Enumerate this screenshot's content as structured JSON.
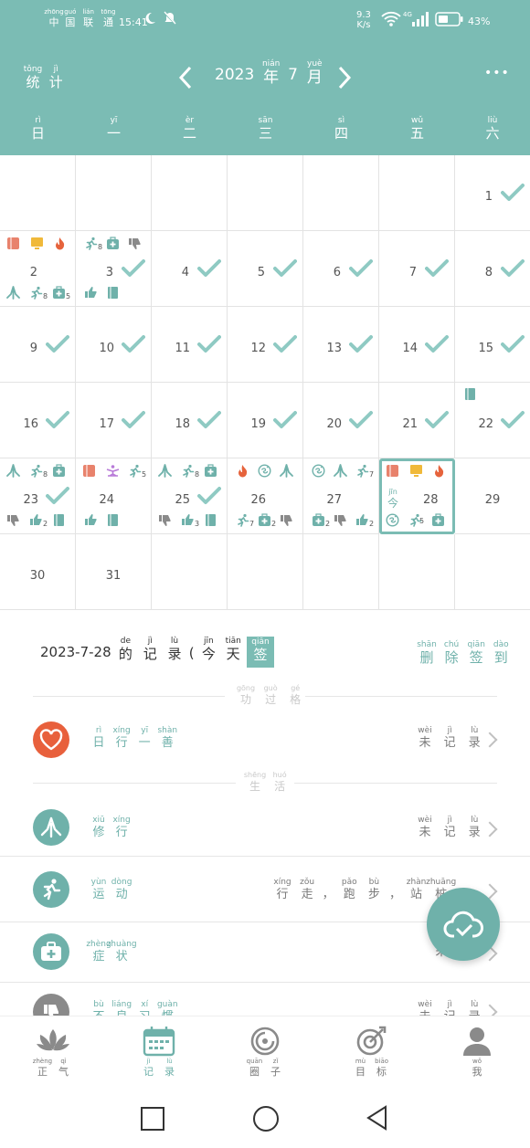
{
  "status_bar": {
    "carrier": [
      {
        "py": "zhōng",
        "hz": "中"
      },
      {
        "py": "guó",
        "hz": "国"
      },
      {
        "py": "lián",
        "hz": "联"
      },
      {
        "py": "tōng",
        "hz": "通"
      }
    ],
    "time": "15:41",
    "net_speed_top": "9.3",
    "net_speed_bottom": "K/s",
    "net_type": "4G",
    "battery": "43%"
  },
  "header": {
    "stats": [
      {
        "py": "tǒng",
        "hz": "统"
      },
      {
        "py": "jì",
        "hz": "计"
      }
    ],
    "year": "2023",
    "year_char": {
      "py": "nián",
      "hz": "年"
    },
    "month": "7",
    "month_char": {
      "py": "yuè",
      "hz": "月"
    },
    "more": "•••"
  },
  "weekdays": [
    {
      "py": "rì",
      "hz": "日"
    },
    {
      "py": "yī",
      "hz": "一"
    },
    {
      "py": "èr",
      "hz": "二"
    },
    {
      "py": "sān",
      "hz": "三"
    },
    {
      "py": "sì",
      "hz": "四"
    },
    {
      "py": "wǔ",
      "hz": "五"
    },
    {
      "py": "liù",
      "hz": "六"
    }
  ],
  "calendar": {
    "days": [
      "1",
      "2",
      "3",
      "4",
      "5",
      "6",
      "7",
      "8",
      "9",
      "10",
      "11",
      "12",
      "13",
      "14",
      "15",
      "16",
      "17",
      "18",
      "19",
      "20",
      "21",
      "22",
      "23",
      "24",
      "25",
      "26",
      "27",
      "28",
      "29",
      "30",
      "31"
    ],
    "today_label": {
      "py": "jīn",
      "hz": "今"
    },
    "icon_counts": {
      "d2_run": "8",
      "d2_med": "5",
      "d3_run": "8",
      "d23_run": "8",
      "d23_thumb": "2",
      "d24_run": "5",
      "d25_run": "8",
      "d25_thumb": "3",
      "d26_run": "7",
      "d26_med": "2",
      "d27_run": "7",
      "d27_med": "2",
      "d27_thumb": "2",
      "d28_run": "5"
    },
    "colors": {
      "check": "#8fcac3",
      "book": "#e8826c",
      "tv": "#f0b93a",
      "fire": "#e6633c",
      "teal_icon": "#6fb1aa",
      "purple": "#b87ad8",
      "gray_icon": "#8a8a8a"
    }
  },
  "record": {
    "date": "2023-7-28",
    "title_chars": [
      {
        "py": "de",
        "hz": "的"
      },
      {
        "py": "jì",
        "hz": "记"
      },
      {
        "py": "lù",
        "hz": "录"
      }
    ],
    "paren_open": "(",
    "today_chars": [
      {
        "py": "jīn",
        "hz": "今"
      },
      {
        "py": "tiān",
        "hz": "天"
      }
    ],
    "paren_close": ")",
    "sign": {
      "py": "qiān",
      "hz": "签"
    },
    "delete_sign": [
      {
        "py": "shān",
        "hz": "删"
      },
      {
        "py": "chú",
        "hz": "除"
      },
      {
        "py": "qiān",
        "hz": "签"
      },
      {
        "py": "dào",
        "hz": "到"
      }
    ]
  },
  "sections": {
    "merit": [
      {
        "py": "gōng",
        "hz": "功"
      },
      {
        "py": "guò",
        "hz": "过"
      },
      {
        "py": "gé",
        "hz": "格"
      }
    ],
    "life": [
      {
        "py": "shēng",
        "hz": "生"
      },
      {
        "py": "huó",
        "hz": "活"
      }
    ]
  },
  "rows": [
    {
      "title": [
        {
          "py": "rì",
          "hz": "日"
        },
        {
          "py": "xíng",
          "hz": "行"
        },
        {
          "py": "yī",
          "hz": "一"
        },
        {
          "py": "shàn",
          "hz": "善"
        }
      ],
      "status": [
        {
          "py": "wèi",
          "hz": "未"
        },
        {
          "py": "jì",
          "hz": "记"
        },
        {
          "py": "lù",
          "hz": "录"
        }
      ]
    },
    {
      "title": [
        {
          "py": "xiū",
          "hz": "修"
        },
        {
          "py": "xíng",
          "hz": "行"
        }
      ],
      "status": [
        {
          "py": "wèi",
          "hz": "未"
        },
        {
          "py": "jì",
          "hz": "记"
        },
        {
          "py": "lù",
          "hz": "录"
        }
      ]
    },
    {
      "title": [
        {
          "py": "yùn",
          "hz": "运"
        },
        {
          "py": "dòng",
          "hz": "动"
        }
      ],
      "status": [
        {
          "py": "xíng",
          "hz": "行"
        },
        {
          "py": "zǒu",
          "hz": "走"
        },
        {
          "py": "",
          "hz": "，"
        },
        {
          "py": "pǎo",
          "hz": "跑"
        },
        {
          "py": "bù",
          "hz": "步"
        },
        {
          "py": "",
          "hz": "，"
        },
        {
          "py": "zhàn",
          "hz": "站"
        },
        {
          "py": "zhuāng",
          "hz": "桩"
        }
      ]
    },
    {
      "title": [
        {
          "py": "zhèng",
          "hz": "症"
        },
        {
          "py": "zhuàng",
          "hz": "状"
        }
      ],
      "status": [
        {
          "py": "",
          "hz": "未"
        }
      ]
    },
    {
      "title": [
        {
          "py": "bù",
          "hz": "不"
        },
        {
          "py": "liáng",
          "hz": "良"
        },
        {
          "py": "xí",
          "hz": "习"
        },
        {
          "py": "guàn",
          "hz": "惯"
        }
      ],
      "status": [
        {
          "py": "wèi",
          "hz": "未"
        },
        {
          "py": "jì",
          "hz": "记"
        },
        {
          "py": "lù",
          "hz": "录"
        }
      ]
    }
  ],
  "bottom_nav": [
    {
      "label": [
        {
          "py": "zhèng",
          "hz": "正"
        },
        {
          "py": "qì",
          "hz": "气"
        }
      ]
    },
    {
      "label": [
        {
          "py": "jì",
          "hz": "记"
        },
        {
          "py": "lù",
          "hz": "录"
        }
      ]
    },
    {
      "label": [
        {
          "py": "quān",
          "hz": "圈"
        },
        {
          "py": "zǐ",
          "hz": "子"
        }
      ]
    },
    {
      "label": [
        {
          "py": "mù",
          "hz": "目"
        },
        {
          "py": "biāo",
          "hz": "标"
        }
      ]
    },
    {
      "label": [
        {
          "py": "wǒ",
          "hz": "我"
        }
      ]
    }
  ]
}
